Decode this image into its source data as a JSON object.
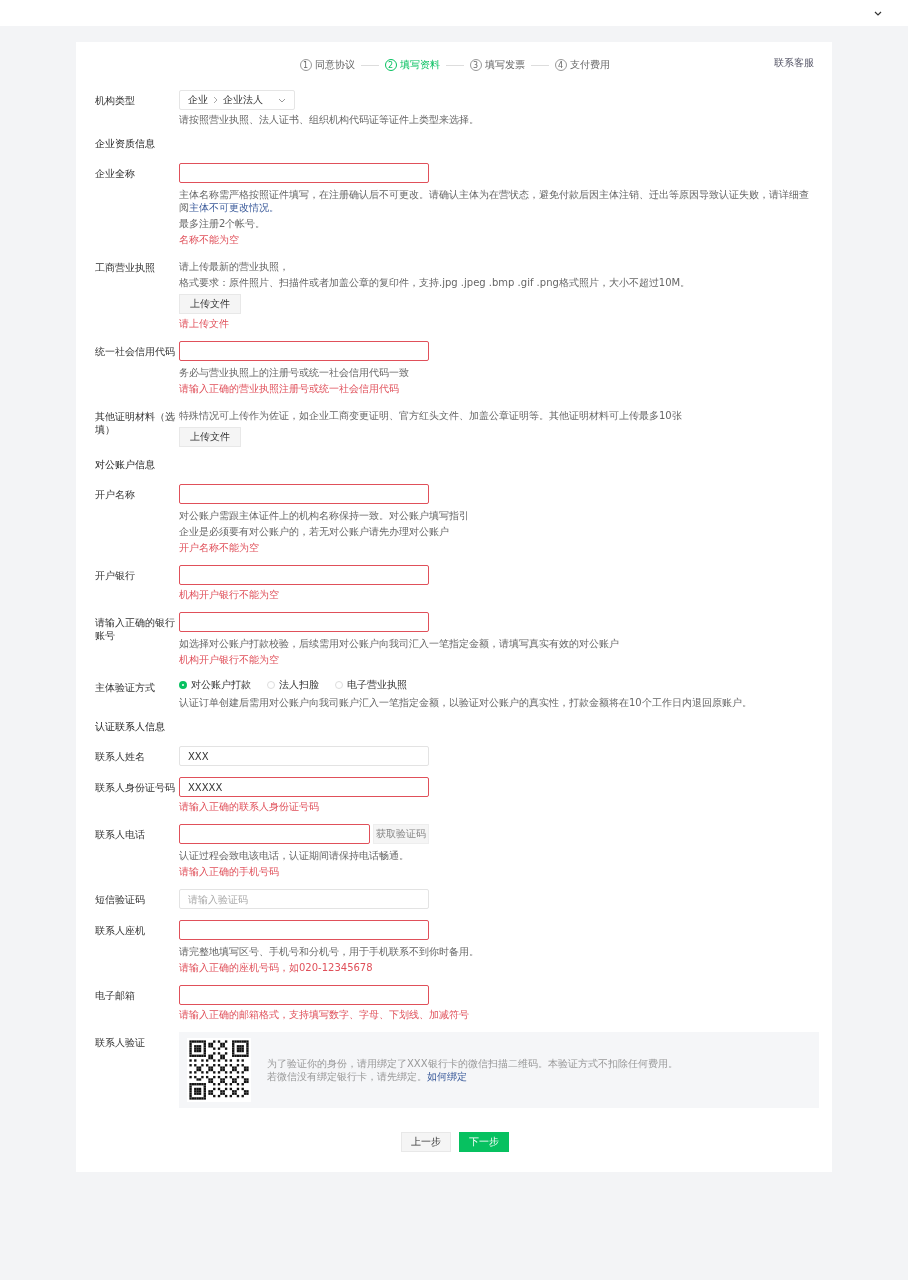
{
  "steps": [
    {
      "number": "1",
      "label": "同意协议",
      "selected": false
    },
    {
      "number": "2",
      "label": "填写资料",
      "selected": true
    },
    {
      "number": "3",
      "label": "填写发票",
      "selected": false
    },
    {
      "number": "4",
      "label": "支付费用",
      "selected": false
    }
  ],
  "contact_link": "联系客服",
  "rows": [
    {
      "kind": "select",
      "label": "机构类型",
      "path": [
        "企业",
        "企业法人"
      ],
      "hints": [
        {
          "text": "请按照营业执照、法人证书、组织机构代码证等证件上类型来选择。"
        }
      ]
    },
    {
      "kind": "section",
      "title": "企业资质信息"
    },
    {
      "kind": "input",
      "label": "企业全称",
      "invalid": true,
      "hints": [
        {
          "text": "主体名称需严格按照证件填写，在注册确认后不可更改。请确认主体为在营状态，避免付款后因主体注销、迁出等原因导致认证失败，请详细查阅",
          "link": "主体不可更改情况。"
        },
        {
          "text": "最多注册2个帐号。"
        }
      ],
      "error": "名称不能为空"
    },
    {
      "kind": "upload",
      "label": "工商营业执照",
      "hints": [
        {
          "text": "请上传最新的营业执照，"
        },
        {
          "text": "格式要求：原件照片、扫描件或者加盖公章的复印件，支持.jpg .jpeg .bmp .gif .png格式照片，大小不超过10M。"
        }
      ],
      "button": "上传文件",
      "error": "请上传文件"
    },
    {
      "kind": "input",
      "label": "统一社会信用代码",
      "invalid": true,
      "hints": [
        {
          "text": "务必与营业执照上的注册号或统一社会信用代码一致"
        }
      ],
      "error": "请输入正确的营业执照注册号或统一社会信用代码"
    },
    {
      "kind": "upload",
      "label": "其他证明材料（选填）",
      "hints": [
        {
          "text": "特殊情况可上传作为佐证，如企业工商变更证明、官方红头文件、加盖公章证明等。其他证明材料可上传最多10张"
        }
      ],
      "button": "上传文件"
    },
    {
      "kind": "section",
      "title": "对公账户信息"
    },
    {
      "kind": "input",
      "label": "开户名称",
      "invalid": true,
      "hints": [
        {
          "text": "对公账户需跟主体证件上的机构名称保持一致。对公账户填写指引"
        },
        {
          "text": "企业是必须要有对公账户的，若无对公账户请先办理对公账户"
        }
      ],
      "error": "开户名称不能为空"
    },
    {
      "kind": "input",
      "label": "开户银行",
      "invalid": true,
      "error": "机构开户银行不能为空"
    },
    {
      "kind": "input",
      "label": "请输入正确的银行账号",
      "invalid": true,
      "hints": [
        {
          "text": "如选择对公账户打款校验，后续需用对公账户向我司汇入一笔指定金额，请填写真实有效的对公账户"
        }
      ],
      "error": "机构开户银行不能为空"
    },
    {
      "kind": "radio",
      "label": "主体验证方式",
      "options": [
        {
          "label": "对公账户打款",
          "selected": true
        },
        {
          "label": "法人扫脸",
          "selected": false
        },
        {
          "label": "电子营业执照",
          "selected": false
        }
      ],
      "hints": [
        {
          "text": "认证订单创建后需用对公账户向我司账户汇入一笔指定金额，以验证对公账户的真实性，打款金额将在10个工作日内退回原账户。"
        }
      ]
    },
    {
      "kind": "section",
      "title": "认证联系人信息"
    },
    {
      "kind": "input",
      "label": "联系人姓名",
      "invalid": false,
      "value": "XXX"
    },
    {
      "kind": "input",
      "label": "联系人身份证号码",
      "invalid": true,
      "value": "XXXXX",
      "error": "请输入正确的联系人身份证号码"
    },
    {
      "kind": "phone",
      "label": "联系人电话",
      "invalid": true,
      "button": "获取验证码",
      "disabled": true,
      "hints": [
        {
          "text": "认证过程会致电该电话，认证期间请保持电话畅通。"
        }
      ],
      "error": "请输入正确的手机号码"
    },
    {
      "kind": "input",
      "label": "短信验证码",
      "invalid": false,
      "placeholder": "请输入验证码"
    },
    {
      "kind": "input",
      "label": "联系人座机",
      "invalid": true,
      "hints": [
        {
          "text": "请完整地填写区号、手机号和分机号，用于手机联系不到你时备用。"
        }
      ],
      "error": "请输入正确的座机号码，如020-12345678"
    },
    {
      "kind": "input",
      "label": "电子邮箱",
      "invalid": true,
      "error": "请输入正确的邮箱格式，支持填写数字、字母、下划线、加减符号"
    },
    {
      "kind": "qr",
      "label": "联系人验证",
      "hints": [
        {
          "text": "为了验证你的身份，请用绑定了XXX银行卡的微信扫描二维码。本验证方式不扣除任何费用。"
        },
        {
          "text": "若微信没有绑定银行卡，请先绑定。",
          "link": "如何绑定"
        }
      ]
    }
  ],
  "buttons": [
    {
      "kind": "secondary",
      "label": "上一步"
    },
    {
      "kind": "primary",
      "label": "下一步"
    }
  ]
}
